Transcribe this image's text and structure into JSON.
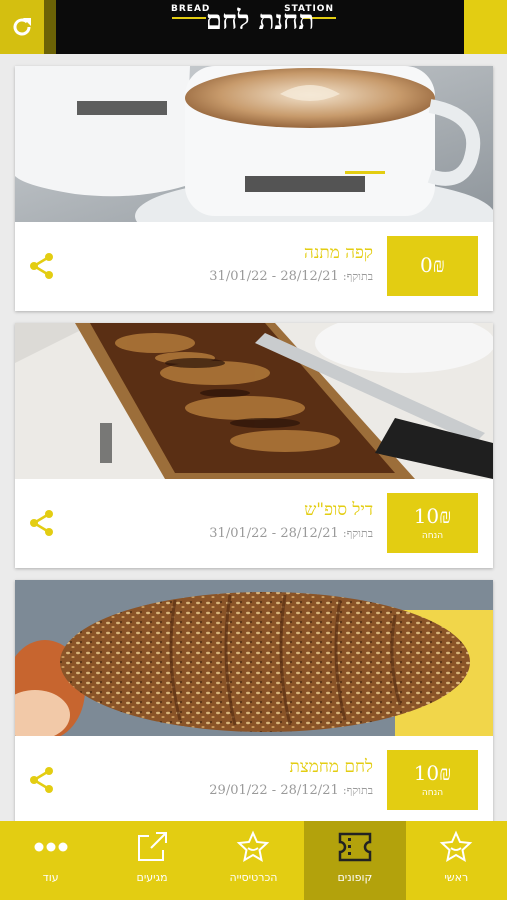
{
  "header": {
    "logo_text": "תחנת לחם",
    "logo_en_left": "BREAD",
    "logo_en_right": "STATION"
  },
  "coupons": [
    {
      "title": "קפה מתנה",
      "price": "0₪",
      "price_sub": "",
      "validity_label": "בתוקף:",
      "validity": "28/12/21 - 31/01/22",
      "image": "coffee-cups"
    },
    {
      "title": "דיל סופ\"ש",
      "price": "10₪",
      "price_sub": "הנחה",
      "validity_label": "בתוקף:",
      "validity": "28/12/21 - 31/01/22",
      "image": "babka-cake"
    },
    {
      "title": "לחם מחמצת",
      "price": "10₪",
      "price_sub": "הנחה",
      "validity_label": "בתוקף:",
      "validity": "28/12/21 - 29/01/22",
      "image": "sourdough-bread"
    }
  ],
  "nav": [
    {
      "label": "עוד",
      "icon": "more-icon"
    },
    {
      "label": "מגיעים",
      "icon": "external-link-icon"
    },
    {
      "label": "הכרטיסייה",
      "icon": "badge-star-icon"
    },
    {
      "label": "קופונים",
      "icon": "ticket-icon",
      "active": true
    },
    {
      "label": "ראשי",
      "icon": "star-icon"
    }
  ],
  "colors": {
    "accent": "#e3cd12",
    "accent_dark": "#b3a20c",
    "muted": "#9a9a9a"
  }
}
